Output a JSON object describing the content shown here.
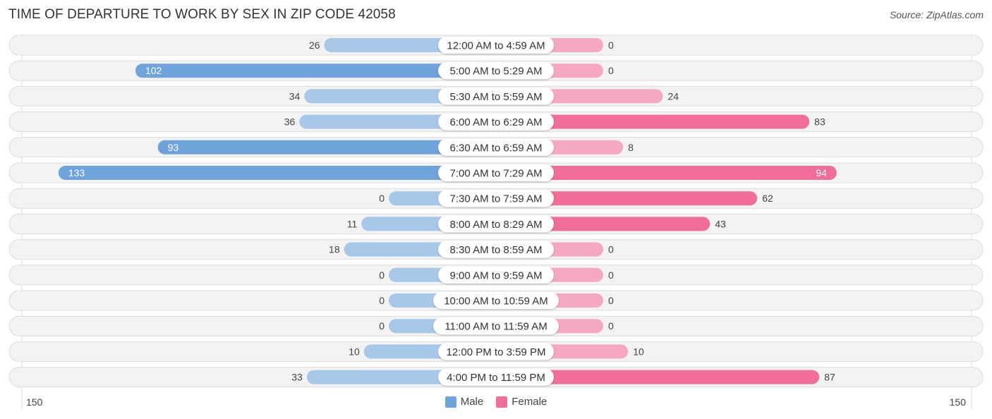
{
  "title": "TIME OF DEPARTURE TO WORK BY SEX IN ZIP CODE 42058",
  "source": "Source: ZipAtlas.com",
  "colors": {
    "male": "#6fa3dc",
    "male_light": "#a8c8ea",
    "female": "#f06e97",
    "female_light": "#f6a8c1",
    "row_bg": "#f3f3f3"
  },
  "chart_data": {
    "type": "bar",
    "orientation": "horizontal-diverging",
    "title": "TIME OF DEPARTURE TO WORK BY SEX IN ZIP CODE 42058",
    "categories": [
      "12:00 AM to 4:59 AM",
      "5:00 AM to 5:29 AM",
      "5:30 AM to 5:59 AM",
      "6:00 AM to 6:29 AM",
      "6:30 AM to 6:59 AM",
      "7:00 AM to 7:29 AM",
      "7:30 AM to 7:59 AM",
      "8:00 AM to 8:29 AM",
      "8:30 AM to 8:59 AM",
      "9:00 AM to 9:59 AM",
      "10:00 AM to 10:59 AM",
      "11:00 AM to 11:59 AM",
      "12:00 PM to 3:59 PM",
      "4:00 PM to 11:59 PM"
    ],
    "series": [
      {
        "name": "Male",
        "values": [
          26,
          102,
          34,
          36,
          93,
          133,
          0,
          11,
          18,
          0,
          0,
          0,
          10,
          33
        ]
      },
      {
        "name": "Female",
        "values": [
          0,
          0,
          24,
          83,
          8,
          94,
          62,
          43,
          0,
          0,
          0,
          0,
          10,
          87
        ]
      }
    ],
    "xlim": [
      150,
      150
    ],
    "axis_left_label": "150",
    "axis_right_label": "150",
    "legend": [
      "Male",
      "Female"
    ],
    "legend_position": "bottom-center",
    "grid": false
  }
}
